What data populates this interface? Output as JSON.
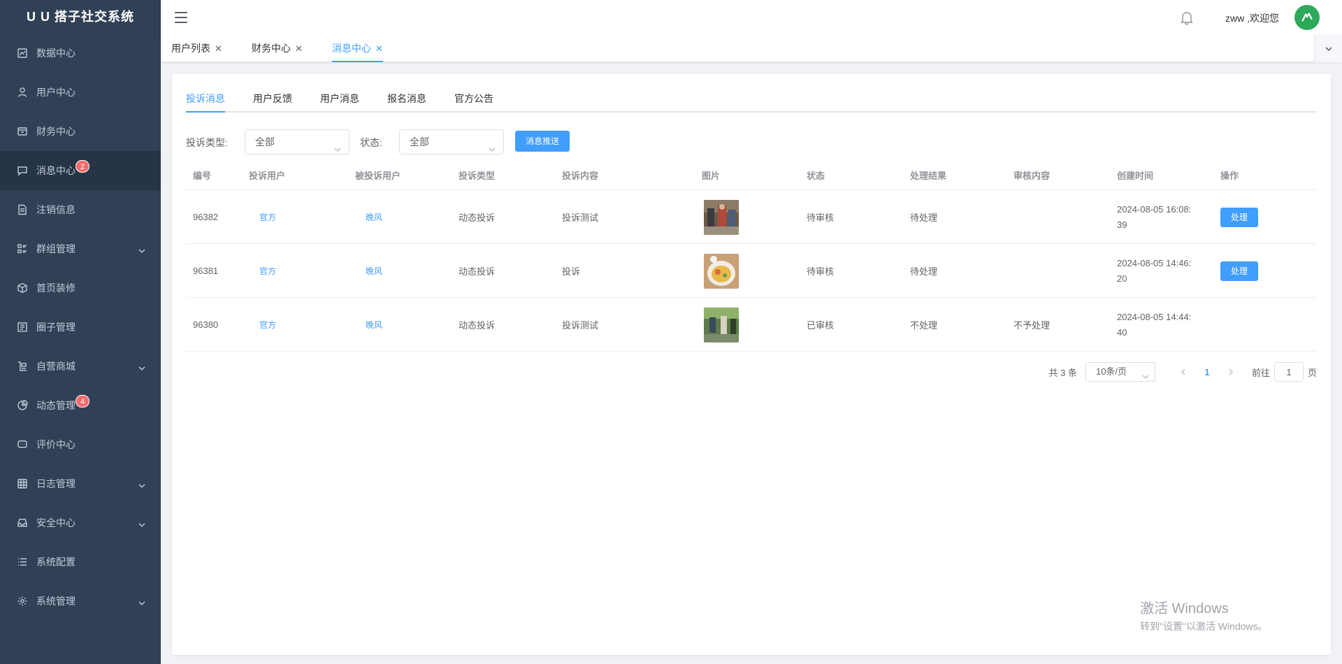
{
  "app": {
    "title": "U U 搭子社交系统"
  },
  "sidebar": {
    "items": [
      {
        "label": "数据中心",
        "icon": "chart-line-icon",
        "badge": null,
        "expandable": false
      },
      {
        "label": "用户中心",
        "icon": "user-icon",
        "badge": null,
        "expandable": false
      },
      {
        "label": "财务中心",
        "icon": "wallet-icon",
        "badge": null,
        "expandable": false
      },
      {
        "label": "消息中心",
        "icon": "message-icon",
        "badge": "2",
        "expandable": false,
        "active": true
      },
      {
        "label": "注销信息",
        "icon": "document-icon",
        "badge": null,
        "expandable": false
      },
      {
        "label": "群组管理",
        "icon": "group-icon",
        "badge": null,
        "expandable": true
      },
      {
        "label": "首页装修",
        "icon": "box-icon",
        "badge": null,
        "expandable": false
      },
      {
        "label": "圈子管理",
        "icon": "board-icon",
        "badge": null,
        "expandable": false
      },
      {
        "label": "自营商城",
        "icon": "shop-icon",
        "badge": null,
        "expandable": true
      },
      {
        "label": "动态管理",
        "icon": "pie-icon",
        "badge": "4",
        "expandable": false
      },
      {
        "label": "评价中心",
        "icon": "comment-icon",
        "badge": null,
        "expandable": false
      },
      {
        "label": "日志管理",
        "icon": "grid-icon",
        "badge": null,
        "expandable": true
      },
      {
        "label": "安全中心",
        "icon": "inbox-icon",
        "badge": null,
        "expandable": true
      },
      {
        "label": "系统配置",
        "icon": "list-icon",
        "badge": null,
        "expandable": false
      },
      {
        "label": "系统管理",
        "icon": "gear-icon",
        "badge": null,
        "expandable": true
      }
    ]
  },
  "header": {
    "welcome": "zww ,欢迎您"
  },
  "tags": [
    {
      "label": "用户列表",
      "active": false
    },
    {
      "label": "财务中心",
      "active": false
    },
    {
      "label": "消息中心",
      "active": true
    }
  ],
  "subtabs": [
    {
      "label": "投诉消息",
      "active": true
    },
    {
      "label": "用户反馈",
      "active": false
    },
    {
      "label": "用户消息",
      "active": false
    },
    {
      "label": "报名消息",
      "active": false
    },
    {
      "label": "官方公告",
      "active": false
    }
  ],
  "filters": {
    "type_label": "投诉类型:",
    "type_value": "全部",
    "status_label": "状态:",
    "status_value": "全部",
    "push_button": "消息推送"
  },
  "table": {
    "columns": [
      "编号",
      "投诉用户",
      "被投诉用户",
      "投诉类型",
      "投诉内容",
      "图片",
      "状态",
      "处理结果",
      "审核内容",
      "创建时间",
      "操作"
    ],
    "rows": [
      {
        "id": "96382",
        "complainant": "官方",
        "respondent": "晚风",
        "type": "动态投诉",
        "content": "投诉测试",
        "image": "photo-market",
        "status": "待审核",
        "result": "待处理",
        "review": "",
        "created": "2024-08-05 16:08:39",
        "action": "处理"
      },
      {
        "id": "96381",
        "complainant": "官方",
        "respondent": "晚风",
        "type": "动态投诉",
        "content": "投诉",
        "image": "photo-food",
        "status": "待审核",
        "result": "待处理",
        "review": "",
        "created": "2024-08-05 14:46:20",
        "action": "处理"
      },
      {
        "id": "96380",
        "complainant": "官方",
        "respondent": "晚风",
        "type": "动态投诉",
        "content": "投诉测试",
        "image": "photo-outdoor",
        "status": "已审核",
        "result": "不处理",
        "review": "不予处理",
        "created": "2024-08-05 14:44:40",
        "action": ""
      }
    ]
  },
  "pagination": {
    "total": "共 3 条",
    "page_size": "10条/页",
    "current_page": "1",
    "goto_label": "前往",
    "goto_value": "1",
    "page_suffix": "页"
  },
  "watermark": {
    "line1": "激活 Windows",
    "line2": "转到\"设置\"以激活 Windows。"
  },
  "colors": {
    "sidebar_bg": "#304156",
    "primary": "#409eff",
    "badge": "#f56c6c",
    "avatar": "#2ea85a"
  }
}
